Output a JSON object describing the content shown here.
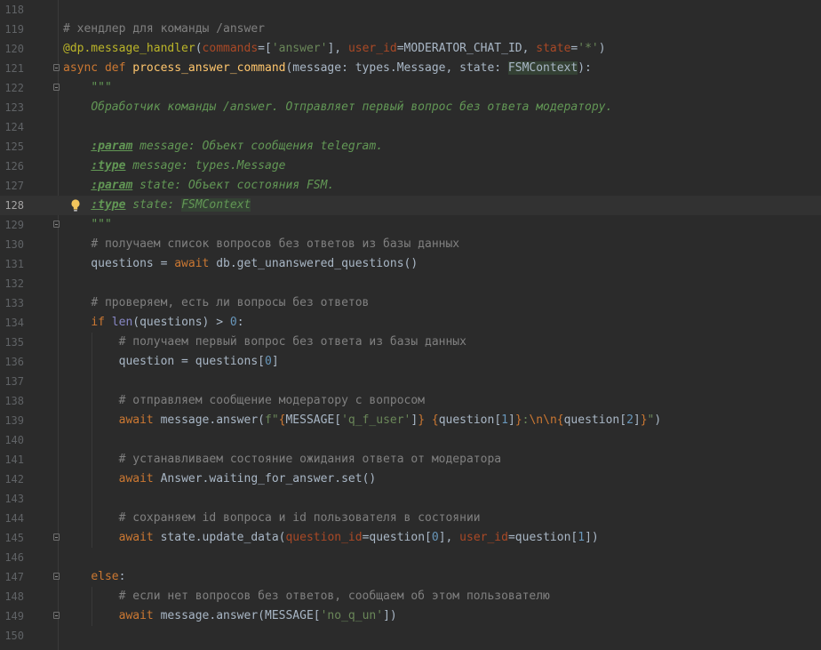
{
  "editor": {
    "caret_line": 128,
    "lines": [
      {
        "n": 118,
        "tokens": []
      },
      {
        "n": 119,
        "tokens": [
          {
            "t": "# хендлер для команды /answer",
            "c": "cmt"
          }
        ]
      },
      {
        "n": 120,
        "tokens": [
          {
            "t": "@dp.message_handler",
            "c": "dec"
          },
          {
            "t": "("
          },
          {
            "t": "commands",
            "c": "param"
          },
          {
            "t": "=["
          },
          {
            "t": "'answer'",
            "c": "str"
          },
          {
            "t": "], "
          },
          {
            "t": "user_id",
            "c": "param"
          },
          {
            "t": "=MODERATOR_CHAT_ID, "
          },
          {
            "t": "state",
            "c": "param"
          },
          {
            "t": "="
          },
          {
            "t": "'*'",
            "c": "str"
          },
          {
            "t": ")"
          }
        ]
      },
      {
        "n": 121,
        "fold": true,
        "tokens": [
          {
            "t": "async def ",
            "c": "kw"
          },
          {
            "t": "process_answer_command",
            "c": "fn"
          },
          {
            "t": "(message: types.Message, state: "
          },
          {
            "t": "FSMContext",
            "c": "hl"
          },
          {
            "t": "):"
          }
        ]
      },
      {
        "n": 122,
        "fold": true,
        "tokens": [
          {
            "t": "    "
          },
          {
            "t": "\"\"\"",
            "c": "doc"
          }
        ]
      },
      {
        "n": 123,
        "tokens": [
          {
            "t": "    "
          },
          {
            "t": "Обработчик команды /answer. Отправляет первый вопрос без ответа модератору.",
            "c": "doc"
          }
        ]
      },
      {
        "n": 124,
        "tokens": []
      },
      {
        "n": 125,
        "tokens": [
          {
            "t": "    "
          },
          {
            "t": ":param",
            "c": "tag"
          },
          {
            "t": " message: Объект сообщения telegram.",
            "c": "doc"
          }
        ]
      },
      {
        "n": 126,
        "tokens": [
          {
            "t": "    "
          },
          {
            "t": ":type",
            "c": "tag"
          },
          {
            "t": " message: types.Message",
            "c": "doc"
          }
        ]
      },
      {
        "n": 127,
        "tokens": [
          {
            "t": "    "
          },
          {
            "t": ":param",
            "c": "tag"
          },
          {
            "t": " state: Объект состояния FSM.",
            "c": "doc"
          }
        ]
      },
      {
        "n": 128,
        "bulb": true,
        "tokens": [
          {
            "t": "    "
          },
          {
            "t": ":type",
            "c": "tag"
          },
          {
            "t": " state: ",
            "c": "doc"
          },
          {
            "t": "FSMContext",
            "c": "doc hl"
          }
        ]
      },
      {
        "n": 129,
        "fold": true,
        "tokens": [
          {
            "t": "    "
          },
          {
            "t": "\"\"\"",
            "c": "doc"
          }
        ]
      },
      {
        "n": 130,
        "tokens": [
          {
            "t": "    "
          },
          {
            "t": "# получаем список вопросов без ответов из базы данных",
            "c": "cmt"
          }
        ]
      },
      {
        "n": 131,
        "tokens": [
          {
            "t": "    questions = "
          },
          {
            "t": "await",
            "c": "kw"
          },
          {
            "t": " db.get_unanswered_questions()"
          }
        ]
      },
      {
        "n": 132,
        "tokens": []
      },
      {
        "n": 133,
        "tokens": [
          {
            "t": "    "
          },
          {
            "t": "# проверяем, есть ли вопросы без ответов",
            "c": "cmt"
          }
        ]
      },
      {
        "n": 134,
        "tokens": [
          {
            "t": "    "
          },
          {
            "t": "if ",
            "c": "kw"
          },
          {
            "t": "len",
            "c": "bi"
          },
          {
            "t": "(questions) > "
          },
          {
            "t": "0",
            "c": "num"
          },
          {
            "t": ":"
          }
        ]
      },
      {
        "n": 135,
        "tokens": [
          {
            "t": "        "
          },
          {
            "t": "# получаем первый вопрос без ответа из базы данных",
            "c": "cmt"
          }
        ]
      },
      {
        "n": 136,
        "tokens": [
          {
            "t": "        question = questions["
          },
          {
            "t": "0",
            "c": "num"
          },
          {
            "t": "]"
          }
        ]
      },
      {
        "n": 137,
        "tokens": []
      },
      {
        "n": 138,
        "tokens": [
          {
            "t": "        "
          },
          {
            "t": "# отправляем сообщение модератору с вопросом",
            "c": "cmt"
          }
        ]
      },
      {
        "n": 139,
        "tokens": [
          {
            "t": "        "
          },
          {
            "t": "await",
            "c": "kw"
          },
          {
            "t": " message.answer("
          },
          {
            "t": "f\"",
            "c": "str"
          },
          {
            "t": "{",
            "c": "esc"
          },
          {
            "t": "MESSAGE["
          },
          {
            "t": "'q_f_user'",
            "c": "str"
          },
          {
            "t": "]"
          },
          {
            "t": "}",
            "c": "esc"
          },
          {
            "t": " ",
            "c": "str"
          },
          {
            "t": "{",
            "c": "esc"
          },
          {
            "t": "question["
          },
          {
            "t": "1",
            "c": "num"
          },
          {
            "t": "]"
          },
          {
            "t": "}",
            "c": "esc"
          },
          {
            "t": ":",
            "c": "str"
          },
          {
            "t": "\\n\\n",
            "c": "esc"
          },
          {
            "t": "{",
            "c": "esc"
          },
          {
            "t": "question["
          },
          {
            "t": "2",
            "c": "num"
          },
          {
            "t": "]"
          },
          {
            "t": "}",
            "c": "esc"
          },
          {
            "t": "\"",
            "c": "str"
          },
          {
            "t": ")"
          }
        ]
      },
      {
        "n": 140,
        "tokens": []
      },
      {
        "n": 141,
        "tokens": [
          {
            "t": "        "
          },
          {
            "t": "# устанавливаем состояние ожидания ответа от модератора",
            "c": "cmt"
          }
        ]
      },
      {
        "n": 142,
        "tokens": [
          {
            "t": "        "
          },
          {
            "t": "await",
            "c": "kw"
          },
          {
            "t": " Answer.waiting_for_answer.set()"
          }
        ]
      },
      {
        "n": 143,
        "tokens": []
      },
      {
        "n": 144,
        "tokens": [
          {
            "t": "        "
          },
          {
            "t": "# сохраняем id вопроса и id пользователя в состоянии",
            "c": "cmt"
          }
        ]
      },
      {
        "n": 145,
        "fold": true,
        "tokens": [
          {
            "t": "        "
          },
          {
            "t": "await",
            "c": "kw"
          },
          {
            "t": " state.update_data("
          },
          {
            "t": "question_id",
            "c": "param"
          },
          {
            "t": "=question["
          },
          {
            "t": "0",
            "c": "num"
          },
          {
            "t": "], "
          },
          {
            "t": "user_id",
            "c": "param"
          },
          {
            "t": "=question["
          },
          {
            "t": "1",
            "c": "num"
          },
          {
            "t": "])"
          }
        ]
      },
      {
        "n": 146,
        "tokens": []
      },
      {
        "n": 147,
        "fold": true,
        "tokens": [
          {
            "t": "    "
          },
          {
            "t": "else",
            "c": "kw"
          },
          {
            "t": ":"
          }
        ]
      },
      {
        "n": 148,
        "tokens": [
          {
            "t": "        "
          },
          {
            "t": "# если нет вопросов без ответов, сообщаем об этом пользователю",
            "c": "cmt"
          }
        ]
      },
      {
        "n": 149,
        "fold": true,
        "tokens": [
          {
            "t": "        "
          },
          {
            "t": "await",
            "c": "kw"
          },
          {
            "t": " message.answer(MESSAGE["
          },
          {
            "t": "'no_q_un'",
            "c": "str"
          },
          {
            "t": "])"
          }
        ]
      },
      {
        "n": 150,
        "tokens": []
      }
    ]
  },
  "colors": {
    "background": "#2b2b2b",
    "caret_row": "#323232",
    "keyword": "#cc7832",
    "function": "#ffc66d",
    "decorator": "#bbb529",
    "string": "#6a8759",
    "comment": "#808080",
    "docstring": "#629755",
    "number": "#6897bb"
  },
  "icons": {
    "intention": "lightbulb-icon",
    "fold": "fold-marker-icon"
  }
}
